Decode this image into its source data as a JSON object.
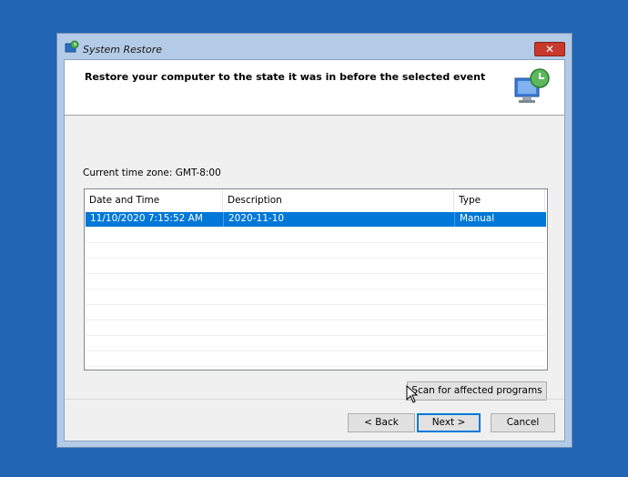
{
  "window": {
    "title": "System Restore",
    "close_label": "✕"
  },
  "header": {
    "instruction": "Restore your computer to the state it was in before the selected event"
  },
  "timezone": "Current time zone: GMT-8:00",
  "table": {
    "columns": [
      "Date and Time",
      "Description",
      "Type"
    ],
    "rows": [
      {
        "date": "11/10/2020 7:15:52 AM",
        "description": "2020-11-10",
        "type": "Manual",
        "selected": true
      }
    ]
  },
  "buttons": {
    "scan": "Scan for affected programs",
    "back": "< Back",
    "next": "Next >",
    "cancel": "Cancel"
  },
  "colors": {
    "desktop": "#2265b4",
    "selection": "#0078d7",
    "close": "#c7392c"
  }
}
